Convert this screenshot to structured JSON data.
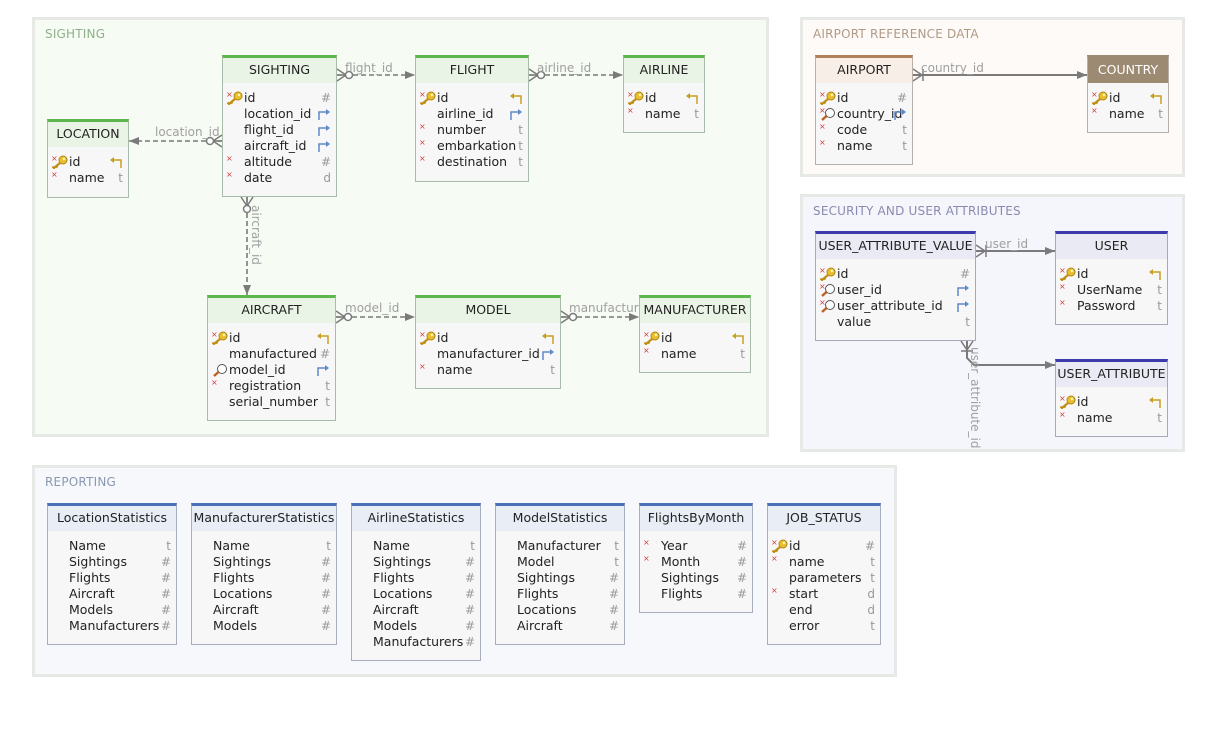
{
  "groups": [
    {
      "id": "sighting",
      "title": "SIGHTING",
      "bg": "#f6fbf4",
      "title_color": "#8fb08a"
    },
    {
      "id": "airport",
      "title": "AIRPORT REFERENCE DATA",
      "bg": "#fdfaf7",
      "title_color": "#b09a86"
    },
    {
      "id": "security",
      "title": "SECURITY AND USER ATTRIBUTES",
      "bg": "#f5f5fc",
      "title_color": "#8a8ab0"
    },
    {
      "id": "reporting",
      "title": "REPORTING",
      "bg": "#f6f8fc",
      "title_color": "#8a98b0"
    }
  ],
  "themes": {
    "green": {
      "top": "#5cb84c",
      "head": "#eaf4e6",
      "border": "#a9bca9",
      "text": "#222"
    },
    "brown": {
      "top": "#b0805a",
      "head": "#f8eee8",
      "border": "#b8b0a8",
      "text": "#222"
    },
    "brownsolid": {
      "top": "#9c8a72",
      "head": "#9c8a72",
      "border": "#b8b0a8",
      "text": "#ffffff"
    },
    "navy": {
      "top": "#3a3aa8",
      "head": "#eaeaf5",
      "border": "#a8a8b8",
      "text": "#222"
    },
    "blue": {
      "top": "#4a70b8",
      "head": "#e8edf6",
      "border": "#a8b0c0",
      "text": "#222"
    }
  },
  "tables": [
    {
      "id": "location",
      "name": "LOCATION",
      "theme": "green",
      "columns": [
        {
          "name": "id",
          "req": true,
          "icon": "key",
          "type": "pk"
        },
        {
          "name": "name",
          "req": true,
          "type": "t"
        }
      ]
    },
    {
      "id": "sighting",
      "name": "SIGHTING",
      "theme": "green",
      "columns": [
        {
          "name": "id",
          "req": true,
          "icon": "key",
          "type": "#"
        },
        {
          "name": "location_id",
          "type": "fk"
        },
        {
          "name": "flight_id",
          "type": "fk"
        },
        {
          "name": "aircraft_id",
          "type": "fk"
        },
        {
          "name": "altitude",
          "req": true,
          "type": "#"
        },
        {
          "name": "date",
          "req": true,
          "type": "d"
        }
      ]
    },
    {
      "id": "flight",
      "name": "FLIGHT",
      "theme": "green",
      "columns": [
        {
          "name": "id",
          "req": true,
          "icon": "key",
          "type": "pk"
        },
        {
          "name": "airline_id",
          "type": "fk"
        },
        {
          "name": "number",
          "req": true,
          "type": "t"
        },
        {
          "name": "embarkation",
          "req": true,
          "type": "t"
        },
        {
          "name": "destination",
          "req": true,
          "type": "t"
        }
      ]
    },
    {
      "id": "airline",
      "name": "AIRLINE",
      "theme": "green",
      "columns": [
        {
          "name": "id",
          "req": true,
          "icon": "key",
          "type": "pk"
        },
        {
          "name": "name",
          "req": true,
          "type": "t"
        }
      ]
    },
    {
      "id": "aircraft",
      "name": "AIRCRAFT",
      "theme": "green",
      "columns": [
        {
          "name": "id",
          "req": true,
          "icon": "key",
          "type": "pk"
        },
        {
          "name": "manufactured",
          "type": "#"
        },
        {
          "name": "model_id",
          "icon": "search",
          "type": "fk"
        },
        {
          "name": "registration",
          "req": true,
          "type": "t"
        },
        {
          "name": "serial_number",
          "type": "t"
        }
      ]
    },
    {
      "id": "model",
      "name": "MODEL",
      "theme": "green",
      "columns": [
        {
          "name": "id",
          "req": true,
          "icon": "key",
          "type": "pk"
        },
        {
          "name": "manufacturer_id",
          "type": "fk"
        },
        {
          "name": "name",
          "req": true,
          "type": "t"
        }
      ]
    },
    {
      "id": "manufacturer",
      "name": "MANUFACTURER",
      "theme": "green",
      "columns": [
        {
          "name": "id",
          "req": true,
          "icon": "key",
          "type": "pk"
        },
        {
          "name": "name",
          "req": true,
          "type": "t"
        }
      ]
    },
    {
      "id": "airport",
      "name": "AIRPORT",
      "theme": "brown",
      "columns": [
        {
          "name": "id",
          "req": true,
          "icon": "key",
          "type": "#"
        },
        {
          "name": "country_id",
          "req": true,
          "icon": "search",
          "type": "fk"
        },
        {
          "name": "code",
          "req": true,
          "type": "t"
        },
        {
          "name": "name",
          "req": true,
          "type": "t"
        }
      ]
    },
    {
      "id": "country",
      "name": "COUNTRY",
      "theme": "brownsolid",
      "columns": [
        {
          "name": "id",
          "req": true,
          "icon": "key",
          "type": "pk"
        },
        {
          "name": "name",
          "req": true,
          "type": "t"
        }
      ]
    },
    {
      "id": "uav",
      "name": "USER_ATTRIBUTE_VALUE",
      "theme": "navy",
      "columns": [
        {
          "name": "id",
          "req": true,
          "icon": "key",
          "type": "#"
        },
        {
          "name": "user_id",
          "req": true,
          "icon": "search",
          "type": "fk"
        },
        {
          "name": "user_attribute_id",
          "req": true,
          "icon": "search",
          "type": "fk"
        },
        {
          "name": "value",
          "type": "t"
        }
      ]
    },
    {
      "id": "user",
      "name": "USER",
      "theme": "navy",
      "columns": [
        {
          "name": "id",
          "req": true,
          "icon": "key",
          "type": "pk"
        },
        {
          "name": "UserName",
          "req": true,
          "type": "t"
        },
        {
          "name": "Password",
          "req": true,
          "type": "t"
        }
      ]
    },
    {
      "id": "user_attribute",
      "name": "USER_ATTRIBUTE",
      "theme": "navy",
      "columns": [
        {
          "name": "id",
          "req": true,
          "icon": "key",
          "type": "pk"
        },
        {
          "name": "name",
          "req": true,
          "type": "t"
        }
      ]
    },
    {
      "id": "locstats",
      "name": "LocationStatistics",
      "theme": "blue",
      "columns": [
        {
          "name": "Name",
          "type": "t"
        },
        {
          "name": "Sightings",
          "type": "#"
        },
        {
          "name": "Flights",
          "type": "#"
        },
        {
          "name": "Aircraft",
          "type": "#"
        },
        {
          "name": "Models",
          "type": "#"
        },
        {
          "name": "Manufacturers",
          "type": "#"
        }
      ]
    },
    {
      "id": "manstats",
      "name": "ManufacturerStatistics",
      "theme": "blue",
      "columns": [
        {
          "name": "Name",
          "type": "t"
        },
        {
          "name": "Sightings",
          "type": "#"
        },
        {
          "name": "Flights",
          "type": "#"
        },
        {
          "name": "Locations",
          "type": "#"
        },
        {
          "name": "Aircraft",
          "type": "#"
        },
        {
          "name": "Models",
          "type": "#"
        }
      ]
    },
    {
      "id": "airstats",
      "name": "AirlineStatistics",
      "theme": "blue",
      "columns": [
        {
          "name": "Name",
          "type": "t"
        },
        {
          "name": "Sightings",
          "type": "#"
        },
        {
          "name": "Flights",
          "type": "#"
        },
        {
          "name": "Locations",
          "type": "#"
        },
        {
          "name": "Aircraft",
          "type": "#"
        },
        {
          "name": "Models",
          "type": "#"
        },
        {
          "name": "Manufacturers",
          "type": "#"
        }
      ]
    },
    {
      "id": "modstats",
      "name": "ModelStatistics",
      "theme": "blue",
      "columns": [
        {
          "name": "Manufacturer",
          "type": "t"
        },
        {
          "name": "Model",
          "type": "t"
        },
        {
          "name": "Sightings",
          "type": "#"
        },
        {
          "name": "Flights",
          "type": "#"
        },
        {
          "name": "Locations",
          "type": "#"
        },
        {
          "name": "Aircraft",
          "type": "#"
        }
      ]
    },
    {
      "id": "fbm",
      "name": "FlightsByMonth",
      "theme": "blue",
      "columns": [
        {
          "name": "Year",
          "req": true,
          "type": "#"
        },
        {
          "name": "Month",
          "req": true,
          "type": "#"
        },
        {
          "name": "Sightings",
          "type": "#"
        },
        {
          "name": "Flights",
          "type": "#"
        }
      ]
    },
    {
      "id": "job",
      "name": "JOB_STATUS",
      "theme": "blue",
      "columns": [
        {
          "name": "id",
          "req": true,
          "icon": "key",
          "type": "#"
        },
        {
          "name": "name",
          "req": true,
          "type": "t"
        },
        {
          "name": "parameters",
          "type": "t"
        },
        {
          "name": "start",
          "req": true,
          "type": "d"
        },
        {
          "name": "end",
          "type": "d"
        },
        {
          "name": "error",
          "type": "t"
        }
      ]
    }
  ],
  "relationships": [
    {
      "id": "r-flight",
      "label": "flight_id",
      "from": "sighting",
      "to": "flight",
      "optional": true
    },
    {
      "id": "r-airline",
      "label": "airline_id",
      "from": "flight",
      "to": "airline",
      "optional": true
    },
    {
      "id": "r-location",
      "label": "location_id",
      "from": "sighting",
      "to": "location",
      "optional": true
    },
    {
      "id": "r-aircraft",
      "label": "aircraft_id",
      "from": "sighting",
      "to": "aircraft",
      "optional": true
    },
    {
      "id": "r-model",
      "label": "model_id",
      "from": "aircraft",
      "to": "model",
      "optional": true
    },
    {
      "id": "r-manufacturer",
      "label": "manufacturer_id",
      "from": "model",
      "to": "manufacturer",
      "optional": true
    },
    {
      "id": "r-country",
      "label": "country_id",
      "from": "airport",
      "to": "country",
      "optional": false
    },
    {
      "id": "r-user",
      "label": "user_id",
      "from": "uav",
      "to": "user",
      "optional": false
    },
    {
      "id": "r-userattr",
      "label": "user_attribute_id",
      "from": "uav",
      "to": "user_attribute",
      "optional": false
    }
  ],
  "icon_names": {
    "required": "required-marker-icon",
    "key": "primary-key-icon",
    "search": "index-icon",
    "pk": "referenced-key-arrow-icon",
    "fk": "foreign-key-arrow-icon"
  },
  "colors": {
    "pk_arrow": "#c8a020",
    "fk_arrow": "#5a8ac8",
    "line": "#7a7a7a",
    "required": "#d04040"
  }
}
